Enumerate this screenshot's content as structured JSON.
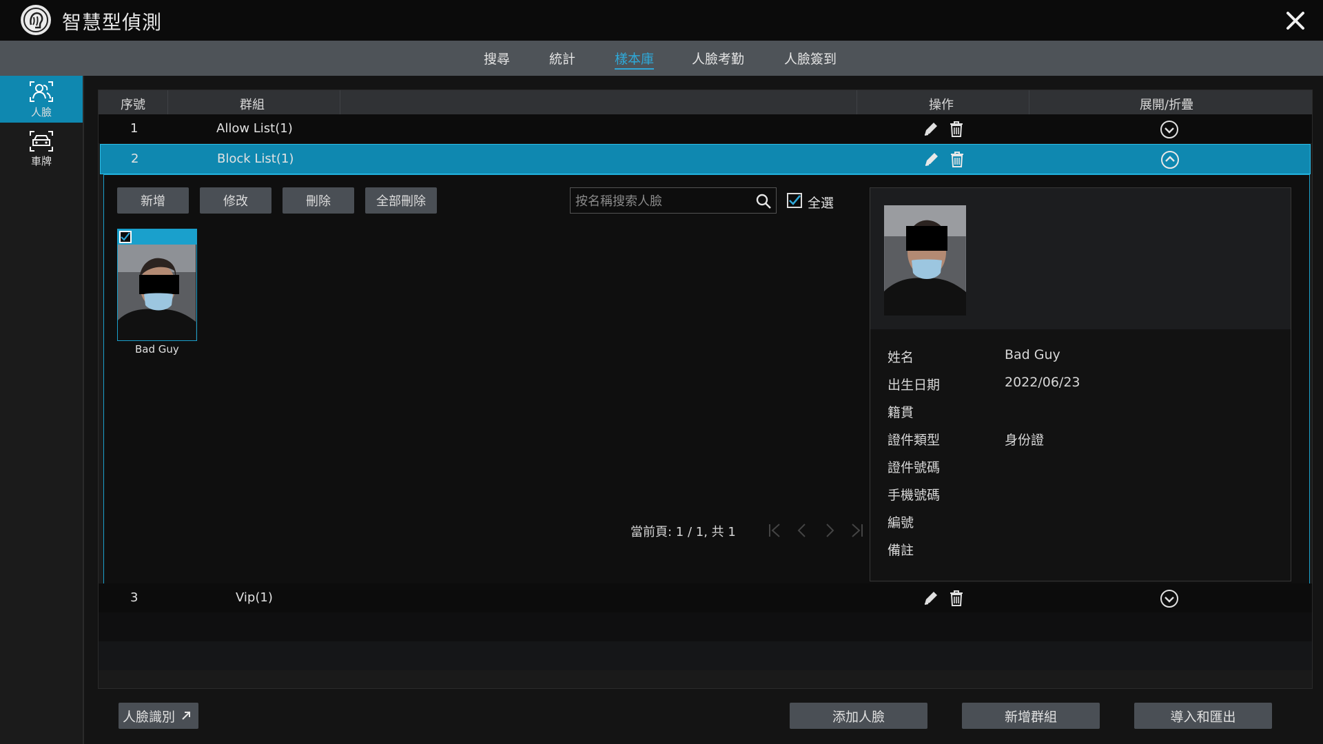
{
  "app": {
    "title": "智慧型偵測"
  },
  "tabs": [
    {
      "label": "搜尋"
    },
    {
      "label": "統計"
    },
    {
      "label": "樣本庫"
    },
    {
      "label": "人臉考勤"
    },
    {
      "label": "人臉簽到"
    }
  ],
  "active_tab": "樣本庫",
  "sidebar": {
    "items": [
      {
        "label": "人臉",
        "icon": "face-icon",
        "active": true
      },
      {
        "label": "車牌",
        "icon": "car-icon",
        "active": false
      }
    ]
  },
  "table": {
    "headers": {
      "index": "序號",
      "group": "群組",
      "ops": "操作",
      "expand": "展開/折疊"
    },
    "rows": [
      {
        "index": "1",
        "group": "Allow List(1)"
      },
      {
        "index": "2",
        "group": "Block List(1)"
      },
      {
        "index": "3",
        "group": "Vip(1)"
      }
    ]
  },
  "group_panel": {
    "buttons": {
      "add": "新增",
      "edit": "修改",
      "delete": "刪除",
      "delete_all": "全部刪除"
    },
    "search_placeholder": "按名稱搜索人臉",
    "select_all_label": "全選",
    "faces": [
      {
        "name": "Bad Guy",
        "checked": true
      }
    ],
    "pager": {
      "text": "當前頁: 1 / 1, 共 1"
    }
  },
  "detail": {
    "fields": [
      {
        "label": "姓名",
        "value": "Bad Guy"
      },
      {
        "label": "出生日期",
        "value": "2022/06/23"
      },
      {
        "label": "籍貫",
        "value": ""
      },
      {
        "label": "證件類型",
        "value": "身份證"
      },
      {
        "label": "證件號碼",
        "value": ""
      },
      {
        "label": "手機號碼",
        "value": ""
      },
      {
        "label": "編號",
        "value": ""
      },
      {
        "label": "備註",
        "value": ""
      }
    ]
  },
  "footer": {
    "face_recognition": "人臉識別",
    "add_face": "添加人臉",
    "add_group": "新增群組",
    "import_export": "導入和匯出"
  },
  "colors": {
    "accent": "#0f88b0",
    "highlight": "#2fa8d8",
    "button": "#4a4f55"
  }
}
